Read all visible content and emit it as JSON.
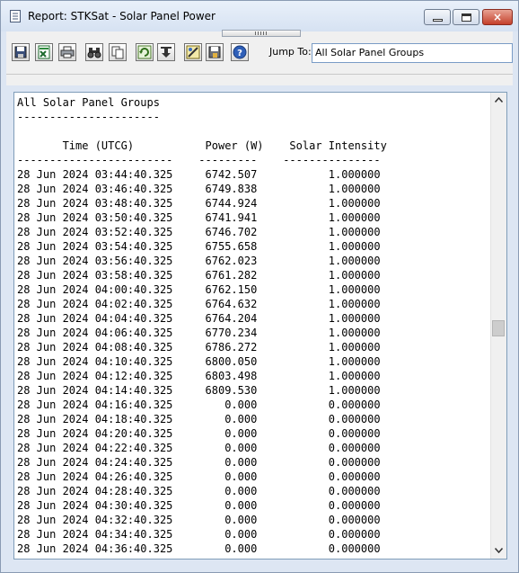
{
  "window": {
    "title": "Report:  STKSat - Solar Panel Power"
  },
  "title_icon": "report-icon",
  "caption_buttons": {
    "minimize": "minimize-icon",
    "maximize": "maximize-icon",
    "close": "×"
  },
  "toolbar": {
    "buttons": [
      {
        "name": "save-icon"
      },
      {
        "name": "export-excel-icon"
      },
      {
        "name": "print-icon"
      },
      {
        "name": "find-icon"
      },
      {
        "name": "copy-icon"
      },
      {
        "name": "refresh-icon"
      },
      {
        "name": "download-icon"
      },
      {
        "name": "properties-icon"
      },
      {
        "name": "save-as-icon"
      },
      {
        "name": "help-icon"
      }
    ],
    "jump_to_label": "Jump To:",
    "jump_to_value": "All Solar Panel Groups"
  },
  "report": {
    "lines": [
      "All Solar Panel Groups",
      "----------------------",
      "",
      "       Time (UTCG)           Power (W)    Solar Intensity",
      "------------------------    ---------    ---------------",
      "28 Jun 2024 03:44:40.325     6742.507           1.000000",
      "28 Jun 2024 03:46:40.325     6749.838           1.000000",
      "28 Jun 2024 03:48:40.325     6744.924           1.000000",
      "28 Jun 2024 03:50:40.325     6741.941           1.000000",
      "28 Jun 2024 03:52:40.325     6746.702           1.000000",
      "28 Jun 2024 03:54:40.325     6755.658           1.000000",
      "28 Jun 2024 03:56:40.325     6762.023           1.000000",
      "28 Jun 2024 03:58:40.325     6761.282           1.000000",
      "28 Jun 2024 04:00:40.325     6762.150           1.000000",
      "28 Jun 2024 04:02:40.325     6764.632           1.000000",
      "28 Jun 2024 04:04:40.325     6764.204           1.000000",
      "28 Jun 2024 04:06:40.325     6770.234           1.000000",
      "28 Jun 2024 04:08:40.325     6786.272           1.000000",
      "28 Jun 2024 04:10:40.325     6800.050           1.000000",
      "28 Jun 2024 04:12:40.325     6803.498           1.000000",
      "28 Jun 2024 04:14:40.325     6809.530           1.000000",
      "28 Jun 2024 04:16:40.325        0.000           0.000000",
      "28 Jun 2024 04:18:40.325        0.000           0.000000",
      "28 Jun 2024 04:20:40.325        0.000           0.000000",
      "28 Jun 2024 04:22:40.325        0.000           0.000000",
      "28 Jun 2024 04:24:40.325        0.000           0.000000",
      "28 Jun 2024 04:26:40.325        0.000           0.000000",
      "28 Jun 2024 04:28:40.325        0.000           0.000000",
      "28 Jun 2024 04:30:40.325        0.000           0.000000",
      "28 Jun 2024 04:32:40.325        0.000           0.000000",
      "28 Jun 2024 04:34:40.325        0.000           0.000000",
      "28 Jun 2024 04:36:40.325        0.000           0.000000"
    ]
  }
}
